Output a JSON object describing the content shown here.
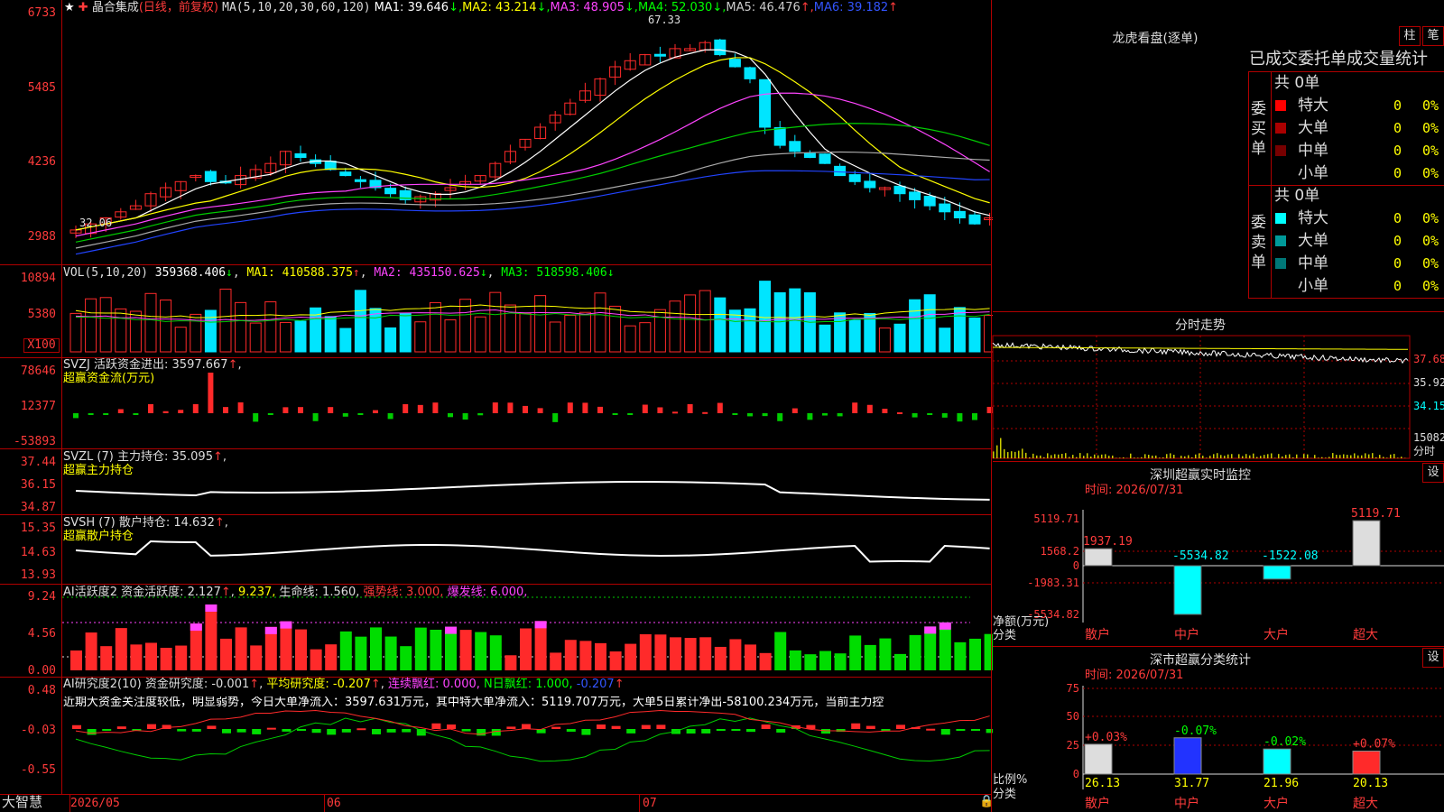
{
  "header": {
    "star_icon": "★",
    "title": "晶合集成",
    "period": "(日线，前复权)",
    "ma_params": "MA(5,10,20,30,60,120)",
    "ma": [
      {
        "label": "MA1: 39.646",
        "arrow": "↓",
        "color": "#ffffff"
      },
      {
        "label": "MA2: 43.214",
        "arrow": "↓",
        "color": "#ffff00"
      },
      {
        "label": "MA3: 48.905",
        "arrow": "↓",
        "color": "#ff44ff"
      },
      {
        "label": "MA4: 52.030",
        "arrow": "↓",
        "color": "#00ff00"
      },
      {
        "label": "MA5: 46.476",
        "arrow": "↑",
        "color": "#cccccc"
      },
      {
        "label": "MA6: 39.182",
        "arrow": "↑",
        "color": "#3355ff"
      }
    ],
    "high_mark": "67.33",
    "low_mark": "32.06"
  },
  "price_axis": [
    "6733",
    "5485",
    "4236",
    "2988"
  ],
  "vol": {
    "label": "VOL(5,10,20)",
    "value": "359368.406",
    "ma1": "MA1: 410588.375",
    "ma2": "MA2: 435150.625",
    "ma3": "MA3: 518598.406",
    "axis": [
      "10894",
      "5380",
      "X100"
    ]
  },
  "svzj": {
    "label": "SVZJ  活跃资金进出: 3597.667",
    "sub": "超赢资金流(万元)",
    "axis": [
      "78646",
      "12377",
      "-53893"
    ]
  },
  "svzl": {
    "label": "SVZL (7) 主力持仓: 35.095",
    "sub": "超赢主力持仓",
    "axis": [
      "37.44",
      "36.15",
      "34.87"
    ]
  },
  "svsh": {
    "label": "SVSH (7) 散户持仓: 14.632",
    "sub": "超赢散户持仓",
    "axis": [
      "15.35",
      "14.63",
      "13.93"
    ]
  },
  "ai1": {
    "label": "AI活跃度2 资金活跃度: 2.127",
    "v2": "9.237,",
    "life": "生命线: 1.560,",
    "strong": "强势线: 3.000,",
    "burst": "爆发线: 6.000,",
    "axis": [
      "9.24",
      "4.56",
      "0.00"
    ]
  },
  "ai2": {
    "label": "AI研究度2(10) 资金研究度: -0.001",
    "avg": "平均研究度: -0.207",
    "red": "连续飘红: 0.000,",
    "nred": "N日飘红: 1.000,",
    "last": "-0.207",
    "text": "近期大资金关注度较低，明显弱势，今日大单净流入：3597.631万元，其中特大单净流入：5119.707万元，大单5日累计净出-58100.234万元，当前主力控",
    "axis": [
      "0.48",
      "-0.03",
      "-0.55"
    ]
  },
  "bottom": {
    "brand": "大智慧",
    "dates": [
      "2026/05",
      "06",
      "07"
    ]
  },
  "dragon_tiger": {
    "title": "龙虎看盘(逐单)",
    "btn_bar": "柱",
    "btn_pen": "笔",
    "table_title": "已成交委托单成交量统计",
    "buy_label": "委买单",
    "sell_label": "委卖单",
    "buy_total": "共 0单",
    "sell_total": "共 0单",
    "rows": [
      {
        "name": "特大",
        "qty": "0",
        "pct": "0%"
      },
      {
        "name": "大单",
        "qty": "0",
        "pct": "0%"
      },
      {
        "name": "中单",
        "qty": "0",
        "pct": "0%"
      },
      {
        "name": "小单",
        "qty": "0",
        "pct": "0%"
      }
    ],
    "buy_colors": [
      "#ff0000",
      "#aa0000",
      "#770000",
      "#000000"
    ],
    "sell_colors": [
      "#00ffff",
      "#009999",
      "#007777",
      "#000000"
    ]
  },
  "intraday": {
    "title": "分时走势",
    "axis": [
      "37.68",
      "35.92",
      "34.15",
      "15082",
      "分时"
    ]
  },
  "sz_monitor": {
    "title": "深圳超赢实时监控",
    "btn": "设",
    "time": "时间: 2026/07/31",
    "axis": [
      "5119.71",
      "1568.2",
      "0",
      "-1983.31",
      "-5534.82"
    ],
    "ylabel": "净额(万元)",
    "xlabel": "分类",
    "categories": [
      "散户",
      "中户",
      "大户",
      "超大"
    ],
    "values": [
      "1937.19",
      "-5534.82",
      "-1522.08",
      "5119.71"
    ]
  },
  "sz_class": {
    "title": "深市超赢分类统计",
    "btn": "设",
    "time": "时间: 2026/07/31",
    "axis": [
      "75",
      "50",
      "25",
      "0"
    ],
    "ylabel": "比例%",
    "xlabel": "分类",
    "categories": [
      "散户",
      "中户",
      "大户",
      "超大"
    ],
    "values": [
      "26.13",
      "31.77",
      "21.96",
      "20.13"
    ],
    "changes": [
      "+0.03%",
      "-0.07%",
      "-0.02%",
      "+0.07%"
    ]
  },
  "chart_data": {
    "type": "bar",
    "title": "深圳超赢实时监控",
    "categories": [
      "散户",
      "中户",
      "大户",
      "超大"
    ],
    "series": [
      {
        "name": "净额(万元)",
        "values": [
          1937.19,
          -5534.82,
          -1522.08,
          5119.71
        ]
      },
      {
        "name": "比例%",
        "values": [
          26.13,
          31.77,
          21.96,
          20.13
        ]
      }
    ]
  }
}
